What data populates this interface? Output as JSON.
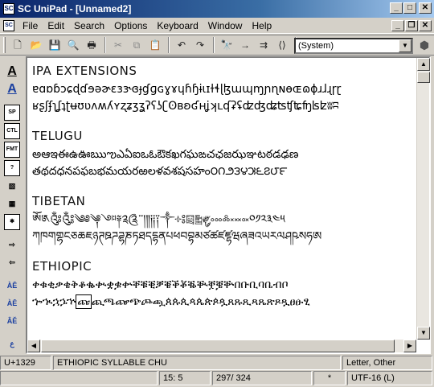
{
  "window": {
    "title": "SC UniPad - [Unnamed2]"
  },
  "menu": {
    "items": [
      "File",
      "Edit",
      "Search",
      "Options",
      "Keyboard",
      "Window",
      "Help"
    ]
  },
  "toolbar": {
    "font_value": "(System)"
  },
  "sidebar": {
    "labels": [
      "SP",
      "CTL",
      "FMT",
      "?"
    ]
  },
  "document": {
    "blocks": [
      {
        "heading": "IPA EXTENSIONS",
        "lines": [
          "ɐɑɒɓɔɕɖɗɘəɚɛɜɝɞɟɠɡɢɣɤɥɦɧɨɩɪɫɬɭɮɯɰɱɲɳɴɵɶɷɸɹɺɻɼɽ",
          "ʁʂʃʄʅʆʇʈʉʊʋʌʍʎʏʐʑʒʓʔʕʖʗʘʙʚʛʜʝʞʟʠʡʢʣʤʥʦʧʨʩʪʫʬʭ"
        ]
      },
      {
        "heading": "TELUGU",
        "lines": [
          "అఆఇఈఉఊఋఌఎఏఐఒఓఔకఖగఘఙచఛజఝఞటఠడఢణ",
          "తథదధనపఫబభమయరఱలళవశషసహం౦౧౨౩౪౫౬౭౮౯"
        ]
      },
      {
        "heading": "TIBETAN",
        "lines": [
          "ༀ༁༂༃༄༅༆༇༈༉༊་༌།༎༏༐༑༒༓༔༕༖༗༘༙༚༛༜༝༞༟༠༡༢༣༤༥",
          "ཀཁགགྷངཅཆཇཉཊཋཌཌྷཎཏཐདདྷནཔཕབབྷམཙཚཛཛྷཝཞཟའཡརལཤཥསཧཨ"
        ]
      },
      {
        "heading": "ETHIOPIC",
        "lines": [
          "ቀቁቂቃቄቅቆቈቊቋቌቍቐቑቒቓቔቕቖቘቚቛቜቝበቡቢባቤብቦ",
          "ኈኊኋኌኍ",
          "ጩ",
          "ጪጫጬጭጮጯጰጱጲጳጴጵጶጷጸጹጺጻጼጽጾጿፀፁፂ"
        ]
      }
    ]
  },
  "status": {
    "codepoint": "U+1329",
    "char_name": "ETHIOPIC SYLLABLE CHU",
    "category": "Letter, Other",
    "position": "15: 5",
    "count": "297/ 324",
    "modified": "*",
    "encoding": "UTF-16 (L)"
  }
}
